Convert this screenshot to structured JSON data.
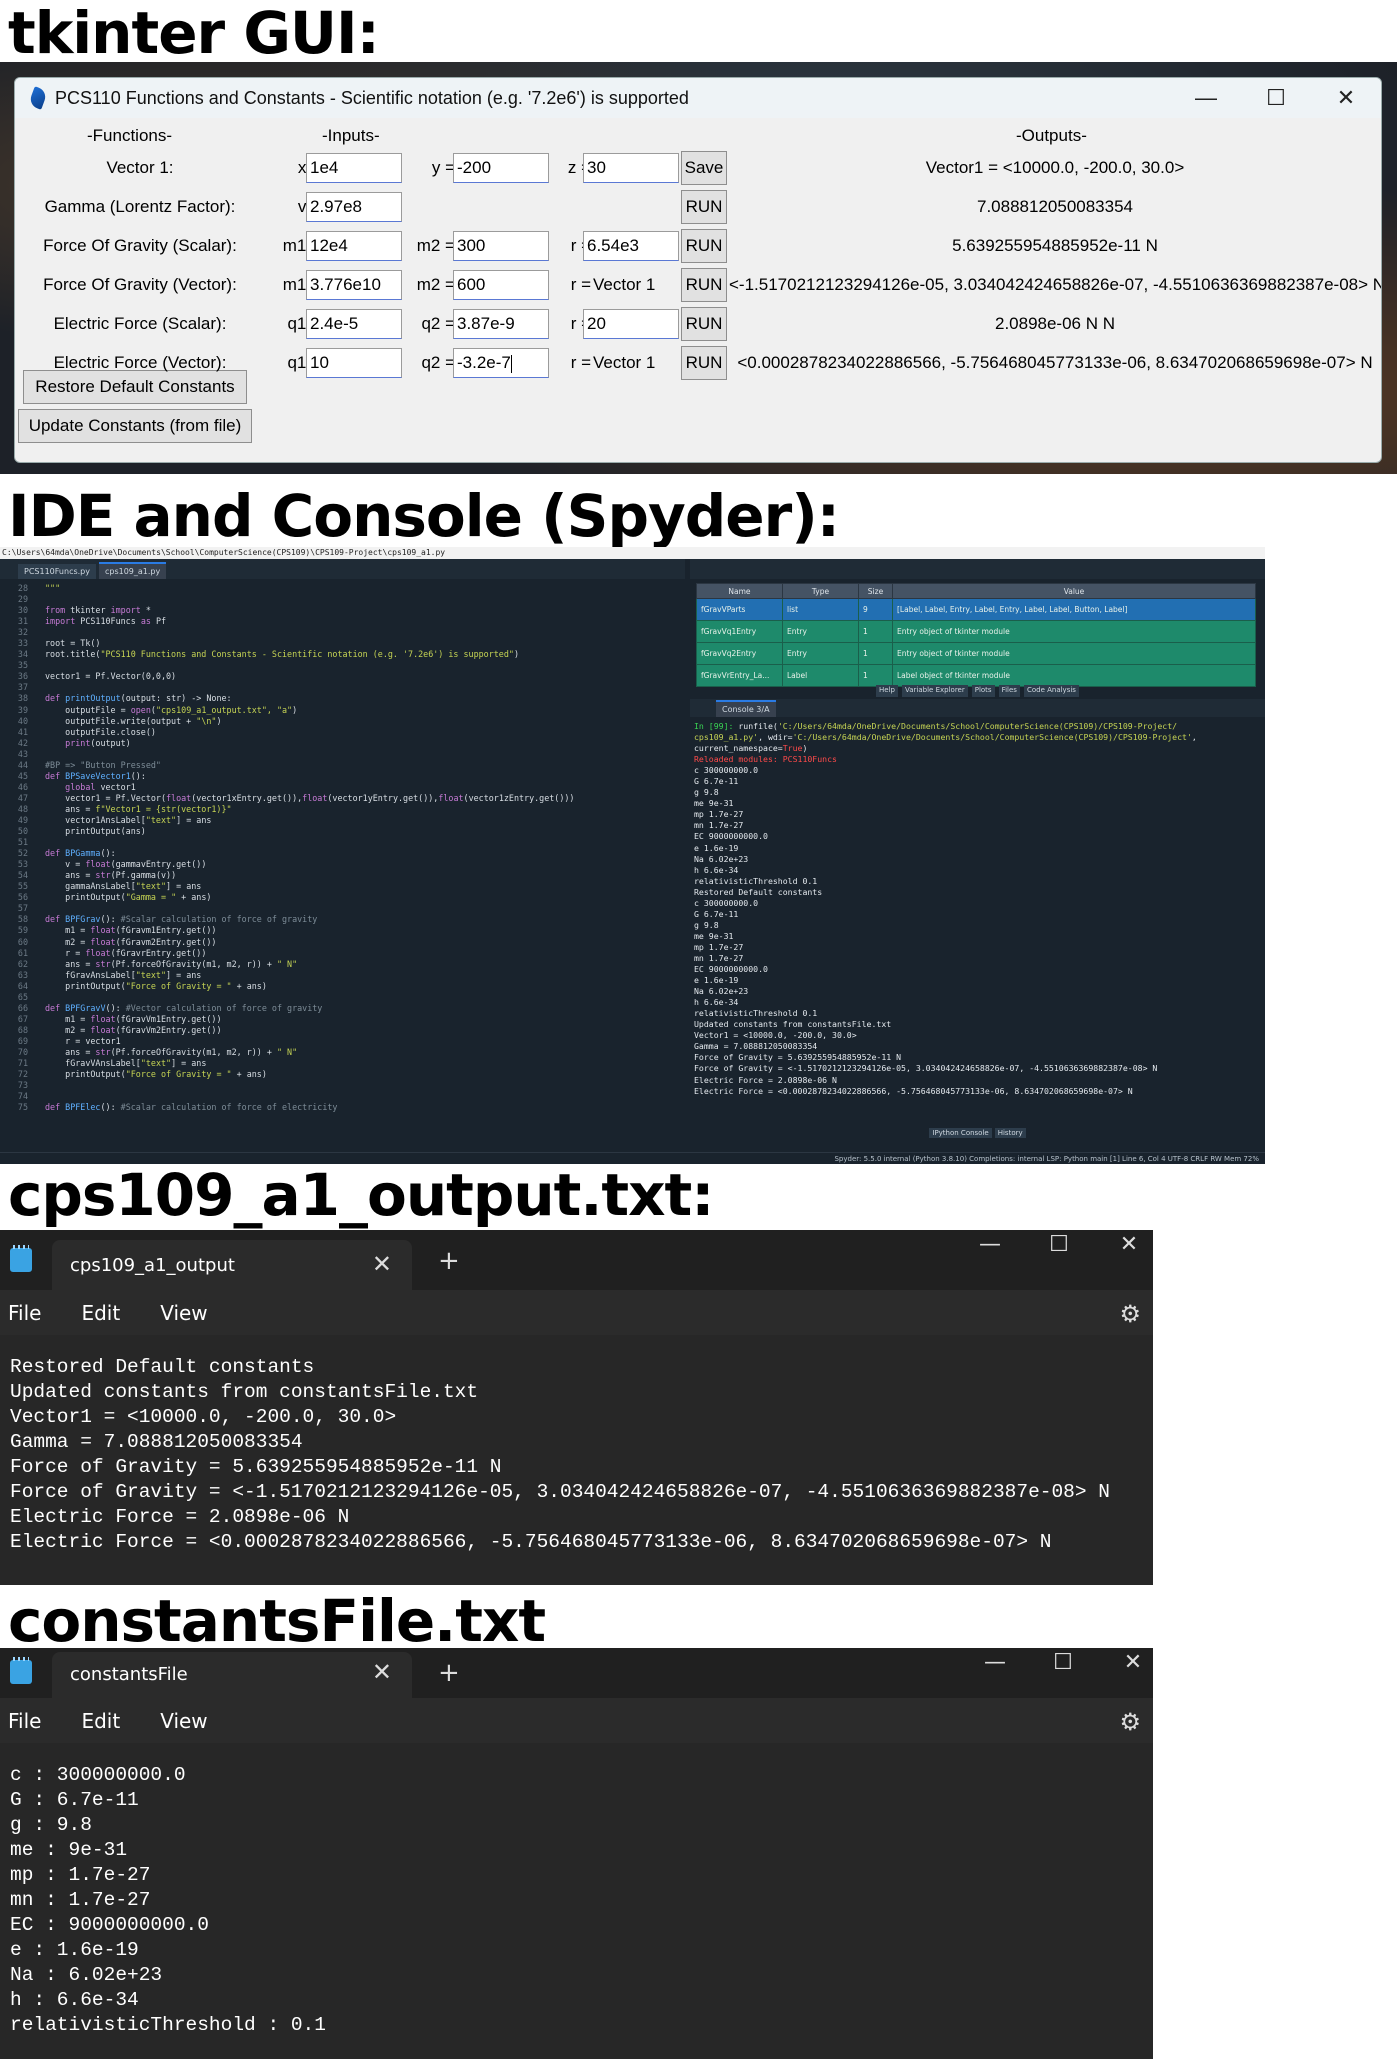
{
  "headings": {
    "tkinter": "tkinter GUI:",
    "ide": "IDE and Console (Spyder):",
    "output_file": "cps109_a1_output.txt:",
    "constants_file": "constantsFile.txt"
  },
  "tk": {
    "title": "PCS110 Functions and Constants - Scientific notation (e.g. '7.2e6') is supported",
    "window_controls": {
      "minimize": "—",
      "maximize": "☐",
      "close": "✕"
    },
    "col_functions": "-Functions-",
    "col_inputs": "-Inputs-",
    "col_outputs": "-Outputs-",
    "rows": [
      {
        "label": "Vector 1:",
        "a_lbl": "x =",
        "a_val": "1e4",
        "b_lbl": "y =",
        "b_val": "-200",
        "c_lbl": "z =",
        "c_val": "30",
        "btn": "Save",
        "out": "Vector1 = <10000.0, -200.0, 30.0>"
      },
      {
        "label": "Gamma (Lorentz Factor):",
        "a_lbl": "v =",
        "a_val": "2.97e8",
        "btn": "RUN",
        "out": "7.088812050083354"
      },
      {
        "label": "Force Of Gravity (Scalar):",
        "a_lbl": "m1 =",
        "a_val": "12e4",
        "b_lbl": "m2 =",
        "b_val": "300",
        "c_lbl": "r =",
        "c_val": "6.54e3",
        "btn": "RUN",
        "out": "5.639255954885952e-11 N"
      },
      {
        "label": "Force Of Gravity (Vector):",
        "a_lbl": "m1 =",
        "a_val": "3.776e10",
        "b_lbl": "m2 =",
        "b_val": "600",
        "c_lbl": "r =",
        "c_text": "Vector 1",
        "btn": "RUN",
        "out": "<-1.5170212123294126e-05, 3.034042424658826e-07, -4.5510636369882387e-08> N"
      },
      {
        "label": "Electric Force (Scalar):",
        "a_lbl": "q1 =",
        "a_val": "2.4e-5",
        "b_lbl": "q2 =",
        "b_val": "3.87e-9",
        "c_lbl": "r =",
        "c_val": "20",
        "btn": "RUN",
        "out": "2.0898e-06 N N"
      },
      {
        "label": "Electric Force (Vector):",
        "a_lbl": "q1 =",
        "a_val": "10",
        "b_lbl": "q2 =",
        "b_val": "-3.2e-7",
        "c_lbl": "r =",
        "c_text": "Vector 1",
        "btn": "RUN",
        "out": "<0.0002878234022886566, -5.756468045773133e-06, 8.634702068659698e-07> N"
      }
    ],
    "restore_btn": "Restore Default Constants",
    "update_btn": "Update Constants (from file)"
  },
  "spyder": {
    "path": "C:\\Users\\64mda\\OneDrive\\Documents\\School\\ComputerScience(CPS109)\\CPS109-Project\\cps109_a1.py",
    "editor_tabs": [
      "PCS110Funcs.py",
      "cps109_a1.py"
    ],
    "var_headers": [
      "Name",
      "Type",
      "Size",
      "Value"
    ],
    "var_rows": [
      [
        "fGravVParts",
        "list",
        "9",
        "[Label, Label, Entry, Label, Entry, Label, Label, Button, Label]"
      ],
      [
        "fGravVq1Entry",
        "Entry",
        "1",
        "Entry object of tkinter module"
      ],
      [
        "fGravVq2Entry",
        "Entry",
        "1",
        "Entry object of tkinter module"
      ],
      [
        "fGravVrEntry_La...",
        "Label",
        "1",
        "Label object of tkinter module"
      ]
    ],
    "var_tabs": [
      "Help",
      "Variable Explorer",
      "Plots",
      "Files",
      "Code Analysis"
    ],
    "console_tab": "Console 3/A",
    "console_bottom_tabs": [
      "IPython Console",
      "History"
    ],
    "status": "Spyder: 5.5.0   internal (Python 3.8.10)   Completions: internal   LSP: Python   main [1]   Line 6, Col 4   UTF-8   CRLF   RW   Mem 72%"
  },
  "output_file": {
    "tab": "cps109_a1_output",
    "menu": [
      "File",
      "Edit",
      "View"
    ],
    "lines": [
      "Restored Default constants",
      "Updated constants from constantsFile.txt",
      "Vector1 = <10000.0, -200.0, 30.0>",
      "Gamma = 7.088812050083354",
      "Force of Gravity = 5.639255954885952e-11 N",
      "Force of Gravity = <-1.5170212123294126e-05, 3.034042424658826e-07, -4.5510636369882387e-08> N",
      "Electric Force = 2.0898e-06 N",
      "Electric Force = <0.0002878234022886566, -5.756468045773133e-06, 8.634702068659698e-07> N"
    ]
  },
  "constants_file": {
    "tab": "constantsFile",
    "menu": [
      "File",
      "Edit",
      "View"
    ],
    "lines": [
      "c : 300000000.0",
      "G : 6.7e-11",
      "g : 9.8",
      "me : 9e-31",
      "mp : 1.7e-27",
      "mn : 1.7e-27",
      "EC : 9000000000.0",
      "e : 1.6e-19",
      "Na : 6.02e+23",
      "h : 6.6e-34",
      "relativisticThreshold : 0.1"
    ]
  },
  "notepad_controls": {
    "minimize": "—",
    "maximize": "☐",
    "close": "✕",
    "new_tab": "+",
    "close_tab": "✕",
    "settings": "⚙"
  }
}
